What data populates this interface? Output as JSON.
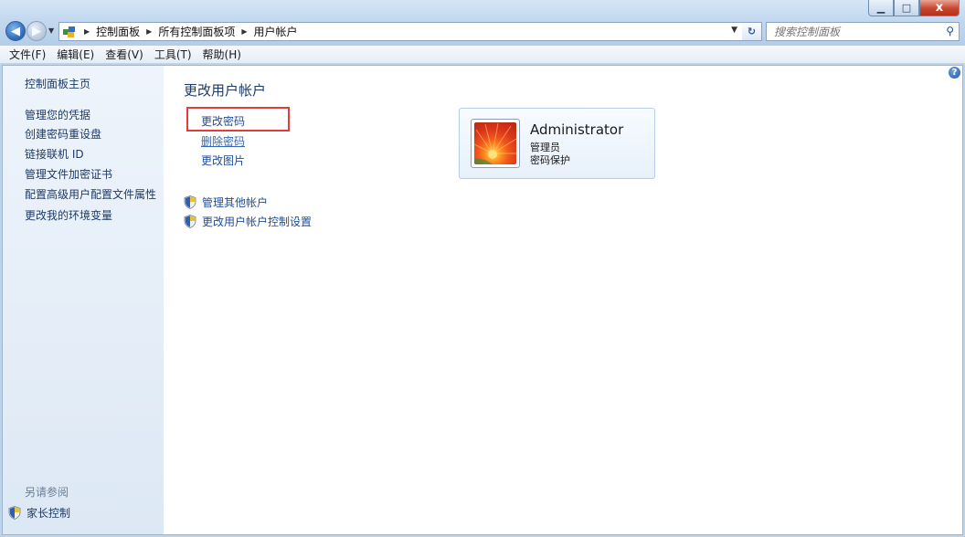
{
  "window": {
    "minimize": "▁",
    "maximize": "□",
    "close": "x"
  },
  "address": {
    "crumbs": [
      "控制面板",
      "所有控制面板项",
      "用户帐户"
    ]
  },
  "search": {
    "placeholder": "搜索控制面板"
  },
  "menu": [
    "文件(F)",
    "编辑(E)",
    "查看(V)",
    "工具(T)",
    "帮助(H)"
  ],
  "sidebar": {
    "home": "控制面板主页",
    "links": [
      "管理您的凭据",
      "创建密码重设盘",
      "链接联机 ID",
      "管理文件加密证书",
      "配置高级用户配置文件属性",
      "更改我的环境变量"
    ],
    "see_also": "另请参阅",
    "parental": "家长控制"
  },
  "main": {
    "title": "更改用户帐户",
    "tasks": [
      "更改密码",
      "删除密码",
      "更改图片"
    ],
    "shield_links": [
      "管理其他帐户",
      "更改用户帐户控制设置"
    ]
  },
  "user": {
    "name": "Administrator",
    "role": "管理员",
    "status": "密码保护"
  },
  "colors": {
    "highlight": "#e23c3c",
    "link": "#1e4d9b"
  }
}
